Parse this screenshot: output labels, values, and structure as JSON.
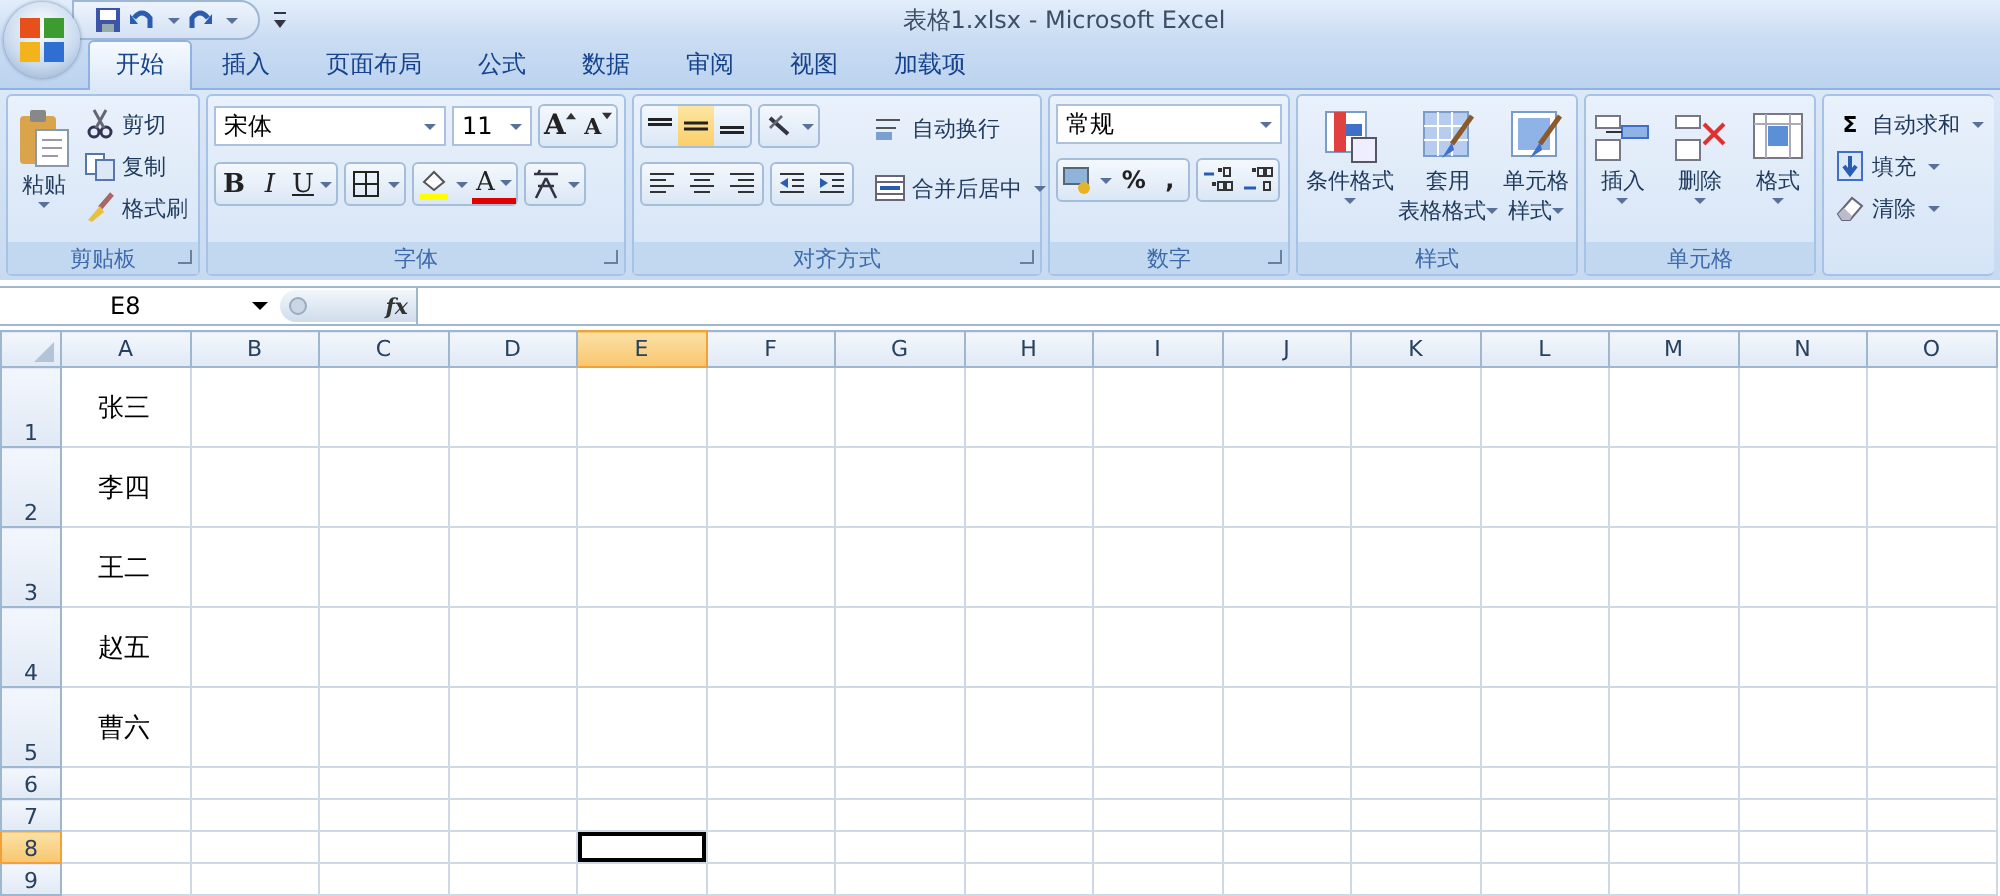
{
  "title_bar": {
    "title": "表格1.xlsx - Microsoft Excel"
  },
  "tabs": [
    {
      "label": "开始",
      "selected": true
    },
    {
      "label": "插入",
      "selected": false
    },
    {
      "label": "页面布局",
      "selected": false
    },
    {
      "label": "公式",
      "selected": false
    },
    {
      "label": "数据",
      "selected": false
    },
    {
      "label": "审阅",
      "selected": false
    },
    {
      "label": "视图",
      "selected": false
    },
    {
      "label": "加载项",
      "selected": false
    }
  ],
  "ribbon": {
    "clipboard": {
      "label": "剪贴板",
      "paste": "粘贴",
      "cut": "剪切",
      "copy": "复制",
      "format_painter": "格式刷"
    },
    "font": {
      "label": "字体",
      "font_name": "宋体",
      "font_size": "11",
      "grow": "A",
      "shrink": "A",
      "bold": "B",
      "italic": "I",
      "underline": "U",
      "font_color": "A"
    },
    "alignment": {
      "label": "对齐方式",
      "vertical_align": [
        {
          "selected": false
        },
        {
          "selected": true
        },
        {
          "selected": false
        }
      ],
      "wrap_text": "自动换行",
      "merge_center": "合并后居中"
    },
    "number": {
      "label": "数字",
      "format": "常规",
      "percent": "%",
      "comma": ","
    },
    "styles": {
      "label": "样式",
      "conditional": "条件格式",
      "table_format": [
        "套用",
        "表格格式"
      ],
      "cell_styles": [
        "单元格",
        "样式"
      ]
    },
    "cells": {
      "label": "单元格",
      "insert": "插入",
      "delete": "删除",
      "format": "格式"
    },
    "editing": {
      "autosum_symbol": "Σ",
      "autosum": "自动求和",
      "fill": "填充",
      "clear": "清除"
    }
  },
  "formula_bar": {
    "name_box": "E8",
    "function_label": "fx"
  },
  "sheet": {
    "columns": [
      {
        "label": "A",
        "selected": false
      },
      {
        "label": "B",
        "selected": false
      },
      {
        "label": "C",
        "selected": false
      },
      {
        "label": "D",
        "selected": false
      },
      {
        "label": "E",
        "selected": true
      },
      {
        "label": "F",
        "selected": false
      },
      {
        "label": "G",
        "selected": false
      },
      {
        "label": "H",
        "selected": false
      },
      {
        "label": "I",
        "selected": false
      },
      {
        "label": "J",
        "selected": false
      },
      {
        "label": "K",
        "selected": false
      },
      {
        "label": "L",
        "selected": false
      },
      {
        "label": "M",
        "selected": false
      },
      {
        "label": "N",
        "selected": false
      },
      {
        "label": "O",
        "selected": false
      }
    ],
    "rows": [
      {
        "label": "1",
        "kind": "tall",
        "selected": false,
        "cells": [
          "张三"
        ]
      },
      {
        "label": "2",
        "kind": "tall",
        "selected": false,
        "cells": [
          "李四"
        ]
      },
      {
        "label": "3",
        "kind": "tall",
        "selected": false,
        "cells": [
          "王二"
        ]
      },
      {
        "label": "4",
        "kind": "tall",
        "selected": false,
        "cells": [
          "赵五"
        ]
      },
      {
        "label": "5",
        "kind": "tall",
        "selected": false,
        "cells": [
          "曹六"
        ]
      },
      {
        "label": "6",
        "kind": "short",
        "selected": false
      },
      {
        "label": "7",
        "kind": "short",
        "selected": false
      },
      {
        "label": "8",
        "kind": "short",
        "selected": true
      },
      {
        "label": "9",
        "kind": "short",
        "selected": false
      }
    ]
  }
}
